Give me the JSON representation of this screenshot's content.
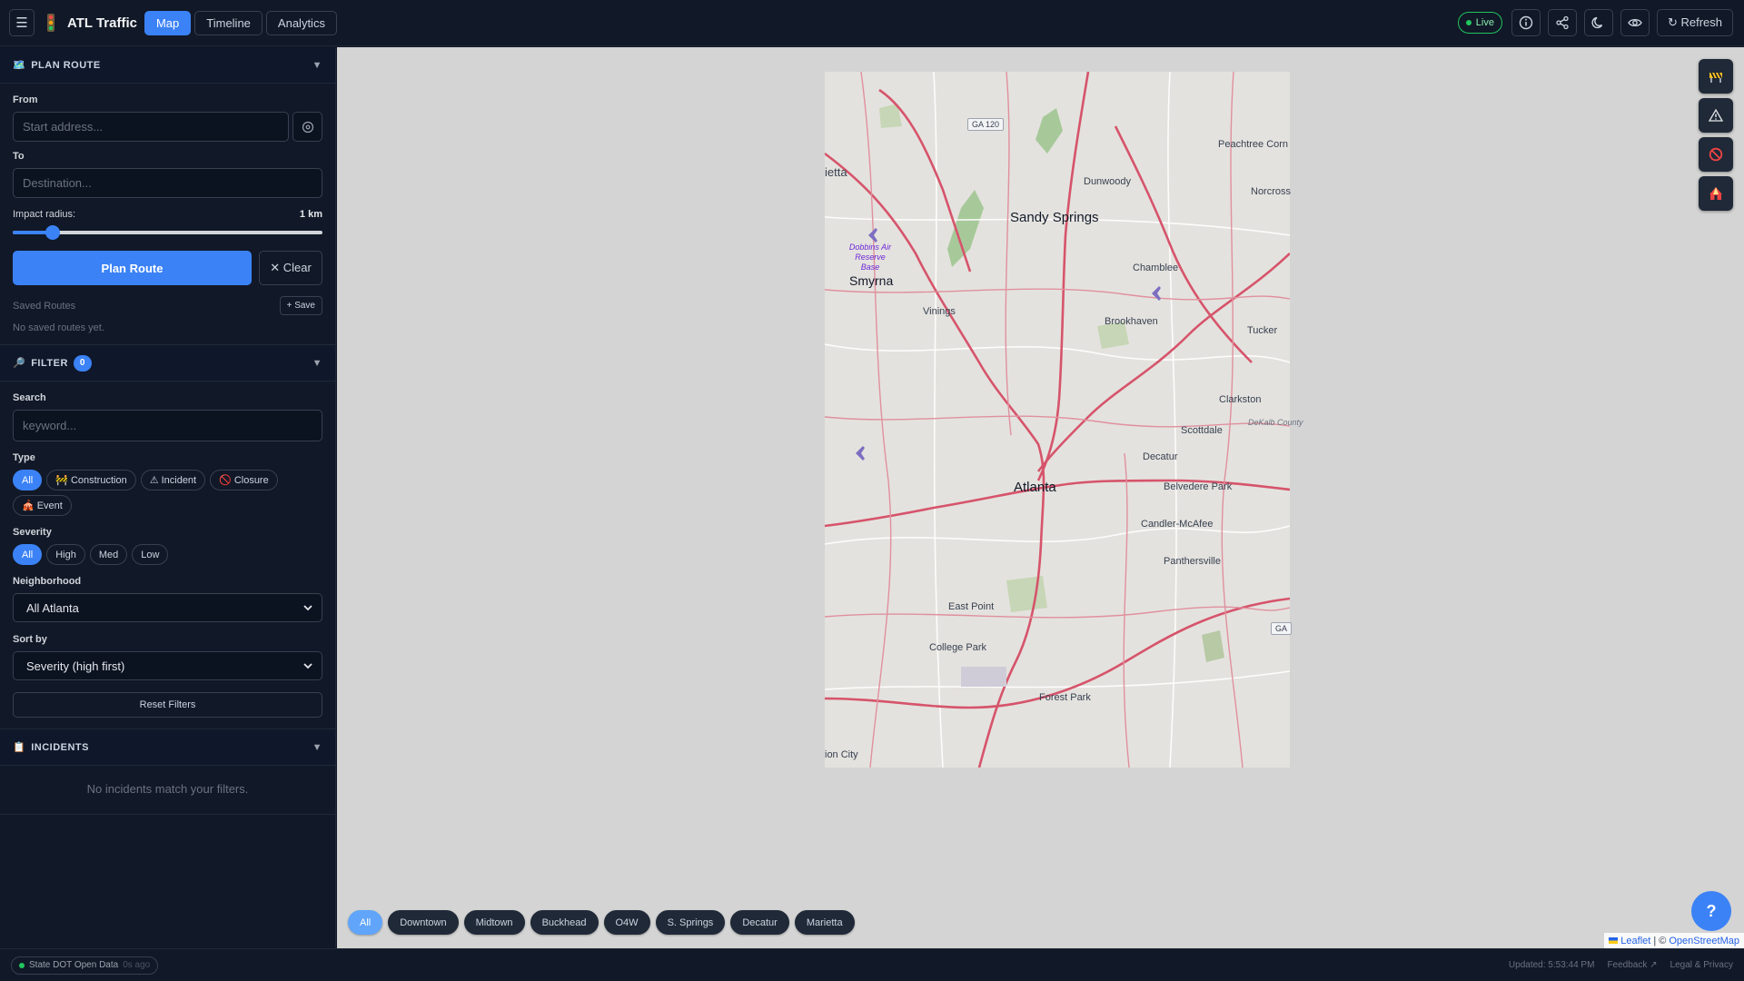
{
  "header": {
    "title": "ATL Traffic",
    "tabs": [
      {
        "label": "Map",
        "active": true
      },
      {
        "label": "Timeline",
        "active": false
      },
      {
        "label": "Analytics",
        "active": false
      }
    ],
    "live_label": "Live",
    "refresh_label": "↻ Refresh",
    "icons": [
      "info-icon",
      "share-icon",
      "moon-icon",
      "eye-icon"
    ]
  },
  "plan_route": {
    "title": "PLAN ROUTE",
    "from_label": "From",
    "from_placeholder": "Start address...",
    "to_label": "To",
    "to_placeholder": "Destination...",
    "radius_label": "Impact radius:",
    "radius_value": "1 km",
    "radius_fraction": 0.13,
    "plan_button": "Plan Route",
    "clear_button": "✕ Clear",
    "saved_label": "Saved Routes",
    "save_button": "+ Save",
    "saved_empty": "No saved routes yet."
  },
  "filter": {
    "title": "FILTER",
    "count": "0",
    "search_label": "Search",
    "search_placeholder": "keyword...",
    "type_label": "Type",
    "types": [
      {
        "label": "All",
        "icon": "",
        "active": true
      },
      {
        "label": "Construction",
        "icon": "🚧",
        "active": false
      },
      {
        "label": "Incident",
        "icon": "⚠",
        "active": false
      },
      {
        "label": "Closure",
        "icon": "🚫",
        "active": false
      },
      {
        "label": "Event",
        "icon": "🎪",
        "active": false
      }
    ],
    "severity_label": "Severity",
    "severities": [
      {
        "label": "All",
        "active": true
      },
      {
        "label": "High",
        "active": false
      },
      {
        "label": "Med",
        "active": false
      },
      {
        "label": "Low",
        "active": false
      }
    ],
    "neighborhood_label": "Neighborhood",
    "neighborhood_value": "All Atlanta",
    "sort_label": "Sort by",
    "sort_value": "Severity (high first)",
    "reset_button": "Reset Filters"
  },
  "incidents": {
    "title": "INCIDENTS",
    "empty": "No incidents match your filters."
  },
  "map": {
    "labels": {
      "sandy_springs": "Sandy Springs",
      "dunwoody": "Dunwoody",
      "peachtree_corners": "Peachtree Corn",
      "norcross": "Norcross",
      "chamblee": "Chamblee",
      "smyrna": "Smyrna",
      "vinings": "Vinings",
      "brookhaven": "Brookhaven",
      "tucker": "Tucker",
      "clarkston": "Clarkston",
      "scottdale": "Scottdale",
      "dekalb": "DeKalb County",
      "decatur": "Decatur",
      "atlanta": "Atlanta",
      "belvedere": "Belvedere Park",
      "candler": "Candler-McAfee",
      "panthersville": "Panthersville",
      "east_point": "East Point",
      "college_park": "College Park",
      "forest_park": "Forest Park",
      "union_city": "ion City",
      "marietta_edge": "ietta",
      "dobbins": "Dobbins Air Reserve Base",
      "ga120": "GA 120",
      "ga_edge": "GA"
    },
    "layer_icons": [
      "construction-icon",
      "incident-icon",
      "closure-icon",
      "event-icon"
    ],
    "neighborhood_pills": [
      {
        "label": "All",
        "active": true
      },
      {
        "label": "Downtown",
        "active": false
      },
      {
        "label": "Midtown",
        "active": false
      },
      {
        "label": "Buckhead",
        "active": false
      },
      {
        "label": "O4W",
        "active": false
      },
      {
        "label": "S. Springs",
        "active": false
      },
      {
        "label": "Decatur",
        "active": false
      },
      {
        "label": "Marietta",
        "active": false
      }
    ],
    "help_label": "?",
    "attribution": {
      "leaflet": "Leaflet",
      "separator": "| ©",
      "osm": "OpenStreetMap"
    }
  },
  "footer": {
    "source": "State DOT Open Data",
    "ago": "0s ago",
    "updated": "Updated: 5:53:44 PM",
    "feedback": "Feedback ↗",
    "legal": "Legal & Privacy"
  },
  "colors": {
    "accent": "#3b82f6",
    "live": "#22c55e",
    "background": "#111827",
    "map_road": "#d6546b"
  }
}
